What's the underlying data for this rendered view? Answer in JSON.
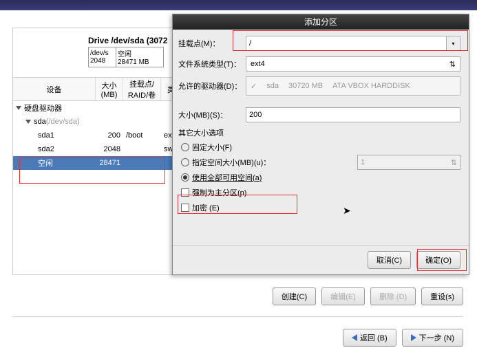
{
  "drive_label": "Drive /dev/sda (3072",
  "drive_box": {
    "dev": "/dev/s",
    "size": "2048",
    "free_label": "空闲",
    "free_size": "28471 MB"
  },
  "tree": {
    "headers": {
      "device": "设备",
      "size": "大小\n(MB)",
      "mount": "挂载点/\nRAID/卷",
      "type": "类"
    },
    "root": "硬盘驱动器",
    "disk": "sda",
    "disk_hint": "(/dev/sda)",
    "rows": [
      {
        "name": "sda1",
        "size": "200",
        "mount": "/boot",
        "type": "ext"
      },
      {
        "name": "sda2",
        "size": "2048",
        "mount": "",
        "type": "swa"
      },
      {
        "name": "空闲",
        "size": "28471",
        "mount": "",
        "type": ""
      }
    ]
  },
  "dialog": {
    "title": "添加分区",
    "labels": {
      "mount": "挂载点(M)：",
      "fstype": "文件系统类型(T)：",
      "drives": "允许的驱动器(D)：",
      "size": "大小(MB)(S)：",
      "other": "其它大小选项",
      "fixed": "固定大小(F)",
      "upto": "指定空间大小(MB)(u)：",
      "all": "使用全部可用空间(a)",
      "primary": "强制为主分区(p)",
      "encrypt": "加密   (E)"
    },
    "values": {
      "mount": "/",
      "fstype": "ext4",
      "drive_check": "✓",
      "drive_name": "sda",
      "drive_size": "30720 MB",
      "drive_model": "ATA VBOX HARDDISK",
      "size": "200",
      "upto": "1"
    },
    "buttons": {
      "cancel": "取消(C)",
      "ok": "确定(O)"
    }
  },
  "toolbar": {
    "create": "创建(C)",
    "edit": "编辑(E)",
    "delete": "删除   (D)",
    "reset": "重设(s)",
    "back": "返回   (B)",
    "next": "下一步   (N)"
  }
}
